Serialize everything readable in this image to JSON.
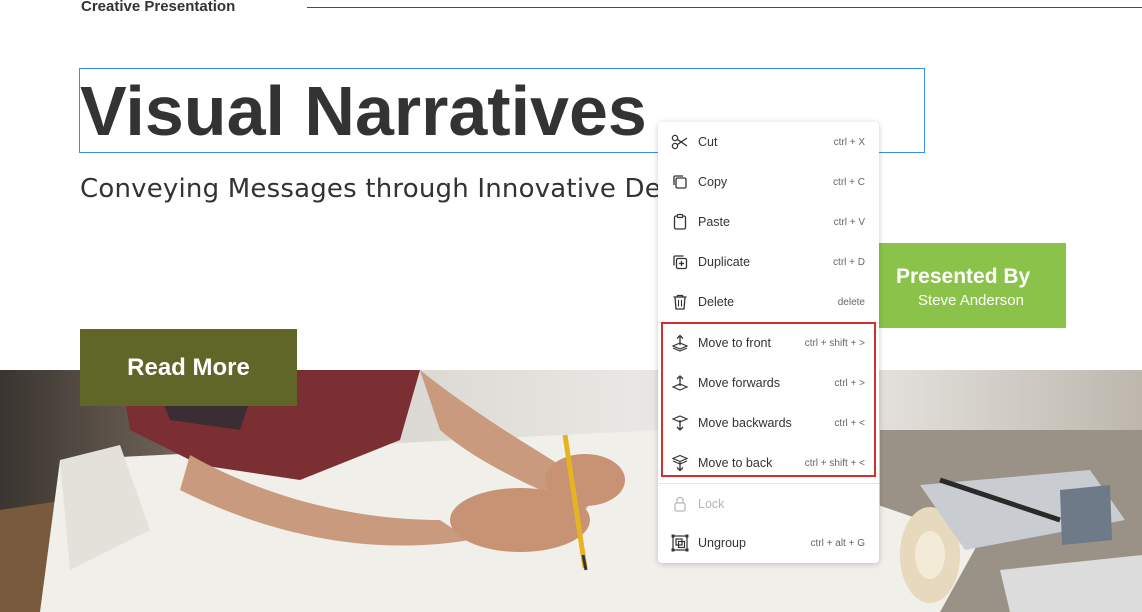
{
  "header": {
    "brand": "Creative Presentation"
  },
  "slide": {
    "title": "Visual Narratives",
    "subtitle": "Conveying Messages through Innovative Designs",
    "presented_by_label": "Presented By",
    "presenter_name": "Steve Anderson",
    "read_more_label": "Read More"
  },
  "context_menu": {
    "items": [
      {
        "label": "Cut",
        "shortcut": "ctrl + X",
        "icon": "scissors-icon"
      },
      {
        "label": "Copy",
        "shortcut": "ctrl + C",
        "icon": "copy-icon"
      },
      {
        "label": "Paste",
        "shortcut": "ctrl + V",
        "icon": "clipboard-icon"
      },
      {
        "label": "Duplicate",
        "shortcut": "ctrl + D",
        "icon": "duplicate-icon"
      },
      {
        "label": "Delete",
        "shortcut": "delete",
        "icon": "trash-icon"
      },
      {
        "label": "Move to front",
        "shortcut": "ctrl + shift + >",
        "icon": "bring-to-front-icon"
      },
      {
        "label": "Move forwards",
        "shortcut": "ctrl + >",
        "icon": "bring-forward-icon"
      },
      {
        "label": "Move backwards",
        "shortcut": "ctrl + <",
        "icon": "send-backward-icon"
      },
      {
        "label": "Move to back",
        "shortcut": "ctrl + shift + <",
        "icon": "send-to-back-icon"
      },
      {
        "label": "Lock",
        "shortcut": "",
        "icon": "lock-icon",
        "disabled": true
      },
      {
        "label": "Ungroup",
        "shortcut": "ctrl + alt + G",
        "icon": "ungroup-icon"
      }
    ]
  },
  "colors": {
    "selection_border": "#3b8fe8",
    "presented_bg": "#8bc34a",
    "read_more_bg": "#5f6627",
    "highlight_border": "#d32f2f",
    "text_dark": "#333333"
  }
}
